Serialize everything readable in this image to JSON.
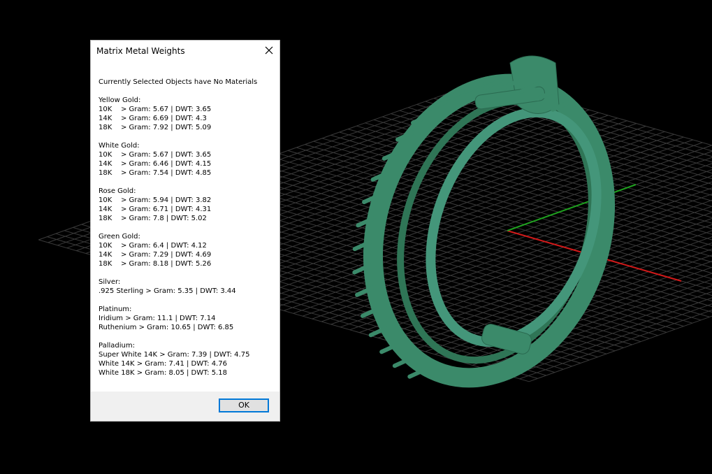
{
  "dialog": {
    "title": "Matrix Metal Weights",
    "headline": "Currently Selected Objects have No Materials",
    "ok_label": "OK",
    "groups": [
      {
        "title": "Yellow Gold:",
        "rows": [
          {
            "karat": "10K",
            "text": "> Gram: 5.67 | DWT: 3.65"
          },
          {
            "karat": "14K",
            "text": "> Gram: 6.69 | DWT: 4.3"
          },
          {
            "karat": "18K",
            "text": "> Gram: 7.92 | DWT: 5.09"
          }
        ]
      },
      {
        "title": "White Gold:",
        "rows": [
          {
            "karat": "10K",
            "text": "> Gram: 5.67 | DWT: 3.65"
          },
          {
            "karat": "14K",
            "text": "> Gram: 6.46 | DWT: 4.15"
          },
          {
            "karat": "18K",
            "text": "> Gram: 7.54 | DWT: 4.85"
          }
        ]
      },
      {
        "title": "Rose Gold:",
        "rows": [
          {
            "karat": "10K",
            "text": "> Gram: 5.94 | DWT: 3.82"
          },
          {
            "karat": "14K",
            "text": "> Gram: 6.71 | DWT: 4.31"
          },
          {
            "karat": "18K",
            "text": "> Gram: 7.8 | DWT: 5.02"
          }
        ]
      },
      {
        "title": "Green Gold:",
        "rows": [
          {
            "karat": "10K",
            "text": "> Gram: 6.4 | DWT: 4.12"
          },
          {
            "karat": "14K",
            "text": "> Gram: 7.29 | DWT: 4.69"
          },
          {
            "karat": "18K",
            "text": "> Gram: 8.18 | DWT: 5.26"
          }
        ]
      },
      {
        "title": "Silver:",
        "rows": [
          {
            "karat": "",
            "text": ".925 Sterling > Gram: 5.35 | DWT: 3.44"
          }
        ]
      },
      {
        "title": "Platinum:",
        "rows": [
          {
            "karat": "",
            "text": "Iridium > Gram: 11.1 | DWT: 7.14"
          },
          {
            "karat": "",
            "text": "Ruthenium > Gram: 10.65 | DWT: 6.85"
          }
        ]
      },
      {
        "title": "Palladium:",
        "rows": [
          {
            "karat": "",
            "text": "Super White 14K > Gram: 7.39 | DWT: 4.75"
          },
          {
            "karat": "",
            "text": "White 14K > Gram: 7.41 | DWT: 4.76"
          },
          {
            "karat": "",
            "text": "White 18K > Gram: 8.05 | DWT: 5.18"
          }
        ]
      }
    ]
  },
  "viewport": {
    "model_color": "#3b8a6a",
    "grid_color": "#3a3a3a",
    "x_axis_color": "#d11a1a",
    "y_axis_color": "#1fa11f"
  }
}
